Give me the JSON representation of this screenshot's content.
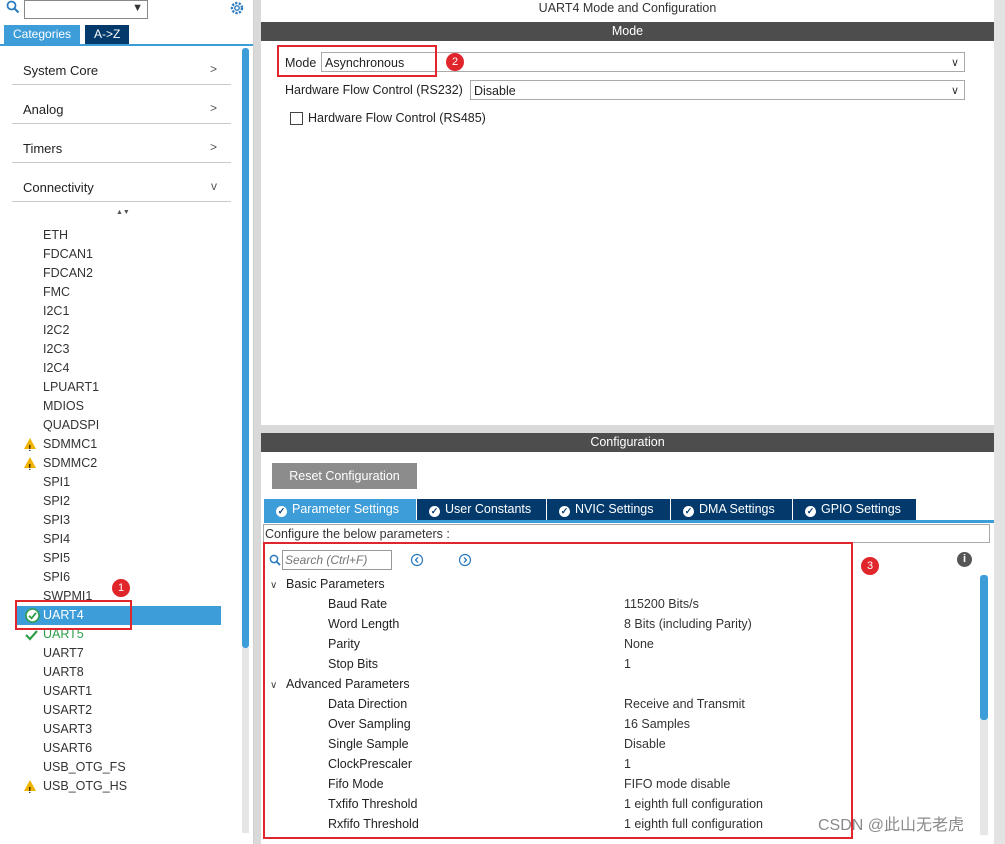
{
  "left": {
    "search": {
      "value": ""
    },
    "tabs": [
      "Categories",
      "A->Z"
    ],
    "categories": [
      {
        "label": "System Core",
        "arrow": ">"
      },
      {
        "label": "Analog",
        "arrow": ">"
      },
      {
        "label": "Timers",
        "arrow": ">"
      },
      {
        "label": "Connectivity",
        "arrow": "v"
      }
    ],
    "sort_glyph": "▲▼",
    "items": [
      "ETH",
      "FDCAN1",
      "FDCAN2",
      "FMC",
      "I2C1",
      "I2C2",
      "I2C3",
      "I2C4",
      "LPUART1",
      "MDIOS",
      "QUADSPI",
      "SDMMC1",
      "SDMMC2",
      "SPI1",
      "SPI2",
      "SPI3",
      "SPI4",
      "SPI5",
      "SPI6",
      "SWPMI1",
      "UART4",
      "UART5",
      "UART7",
      "UART8",
      "USART1",
      "USART2",
      "USART3",
      "USART6",
      "USB_OTG_FS",
      "USB_OTG_HS"
    ],
    "selected_label": "UART4",
    "badge1": "1"
  },
  "right": {
    "window_title": "UART4 Mode and Configuration",
    "mode_header": "Mode",
    "mode_label": "Mode",
    "mode_value": "Asynchronous",
    "hfc232_label": "Hardware Flow Control (RS232)",
    "hfc232_value": "Disable",
    "hfc485_label": "Hardware Flow Control (RS485)",
    "badge2": "2",
    "config_header": "Configuration",
    "reset_button": "Reset Configuration",
    "tabs": [
      "Parameter Settings",
      "User Constants",
      "NVIC Settings",
      "DMA Settings",
      "GPIO Settings"
    ],
    "configure_text": "Configure the below parameters :",
    "search_placeholder": "Search (Ctrl+F)",
    "badge3": "3",
    "groups": [
      {
        "name": "Basic Parameters",
        "params": [
          {
            "name": "Baud Rate",
            "value": "115200 Bits/s"
          },
          {
            "name": "Word Length",
            "value": "8 Bits (including Parity)"
          },
          {
            "name": "Parity",
            "value": "None"
          },
          {
            "name": "Stop Bits",
            "value": "1"
          }
        ]
      },
      {
        "name": "Advanced Parameters",
        "params": [
          {
            "name": "Data Direction",
            "value": "Receive and Transmit"
          },
          {
            "name": "Over Sampling",
            "value": "16 Samples"
          },
          {
            "name": "Single Sample",
            "value": "Disable"
          },
          {
            "name": "ClockPrescaler",
            "value": "1"
          },
          {
            "name": "Fifo Mode",
            "value": "FIFO mode disable"
          },
          {
            "name": "Txfifo Threshold",
            "value": "1 eighth full configuration"
          },
          {
            "name": "Rxfifo Threshold",
            "value": "1 eighth full configuration"
          }
        ]
      }
    ]
  },
  "watermark": "CSDN @此山无老虎",
  "colors": {
    "accent": "#3d9dd9",
    "tab_bg": "#033a6b",
    "header_bg": "#4d4d4d",
    "warn": "#f0b400",
    "ok": "#2e9e4a",
    "red": "#e0262b"
  }
}
